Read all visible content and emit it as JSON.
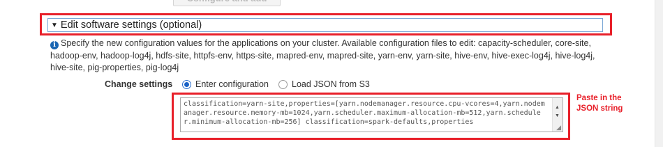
{
  "top_button": {
    "label": "Configure and add"
  },
  "section": {
    "title": "Edit software settings (optional)",
    "info_text": "Specify the new configuration values for the applications on your cluster. Available configuration files to edit: capacity-scheduler, core-site, hadoop-env, hadoop-log4j, hdfs-site, httpfs-env, https-site, mapred-env, mapred-site, yarn-env, yarn-site, hive-env, hive-exec-log4j, hive-log4j, hive-site, pig-properties, pig-log4j"
  },
  "change_settings": {
    "label": "Change settings",
    "options": [
      {
        "label": "Enter configuration",
        "selected": true
      },
      {
        "label": "Load JSON from S3",
        "selected": false
      }
    ]
  },
  "config_textarea": {
    "value": "classification=yarn-site,properties=[yarn.nodemanager.resource.cpu-vcores=4,yarn.nodemanager.resource.memory-mb=1024,yarn.scheduler.maximum-allocation-mb=512,yarn.scheduler.minimum-allocation-mb=256] classification=spark-defaults,properties"
  },
  "annotation": {
    "text": "Paste in the JSON string",
    "color": "#e8202a"
  },
  "colors": {
    "highlight": "#e8202a",
    "radio_selected": "#1a62c6",
    "info_icon": "#1a66b3"
  }
}
